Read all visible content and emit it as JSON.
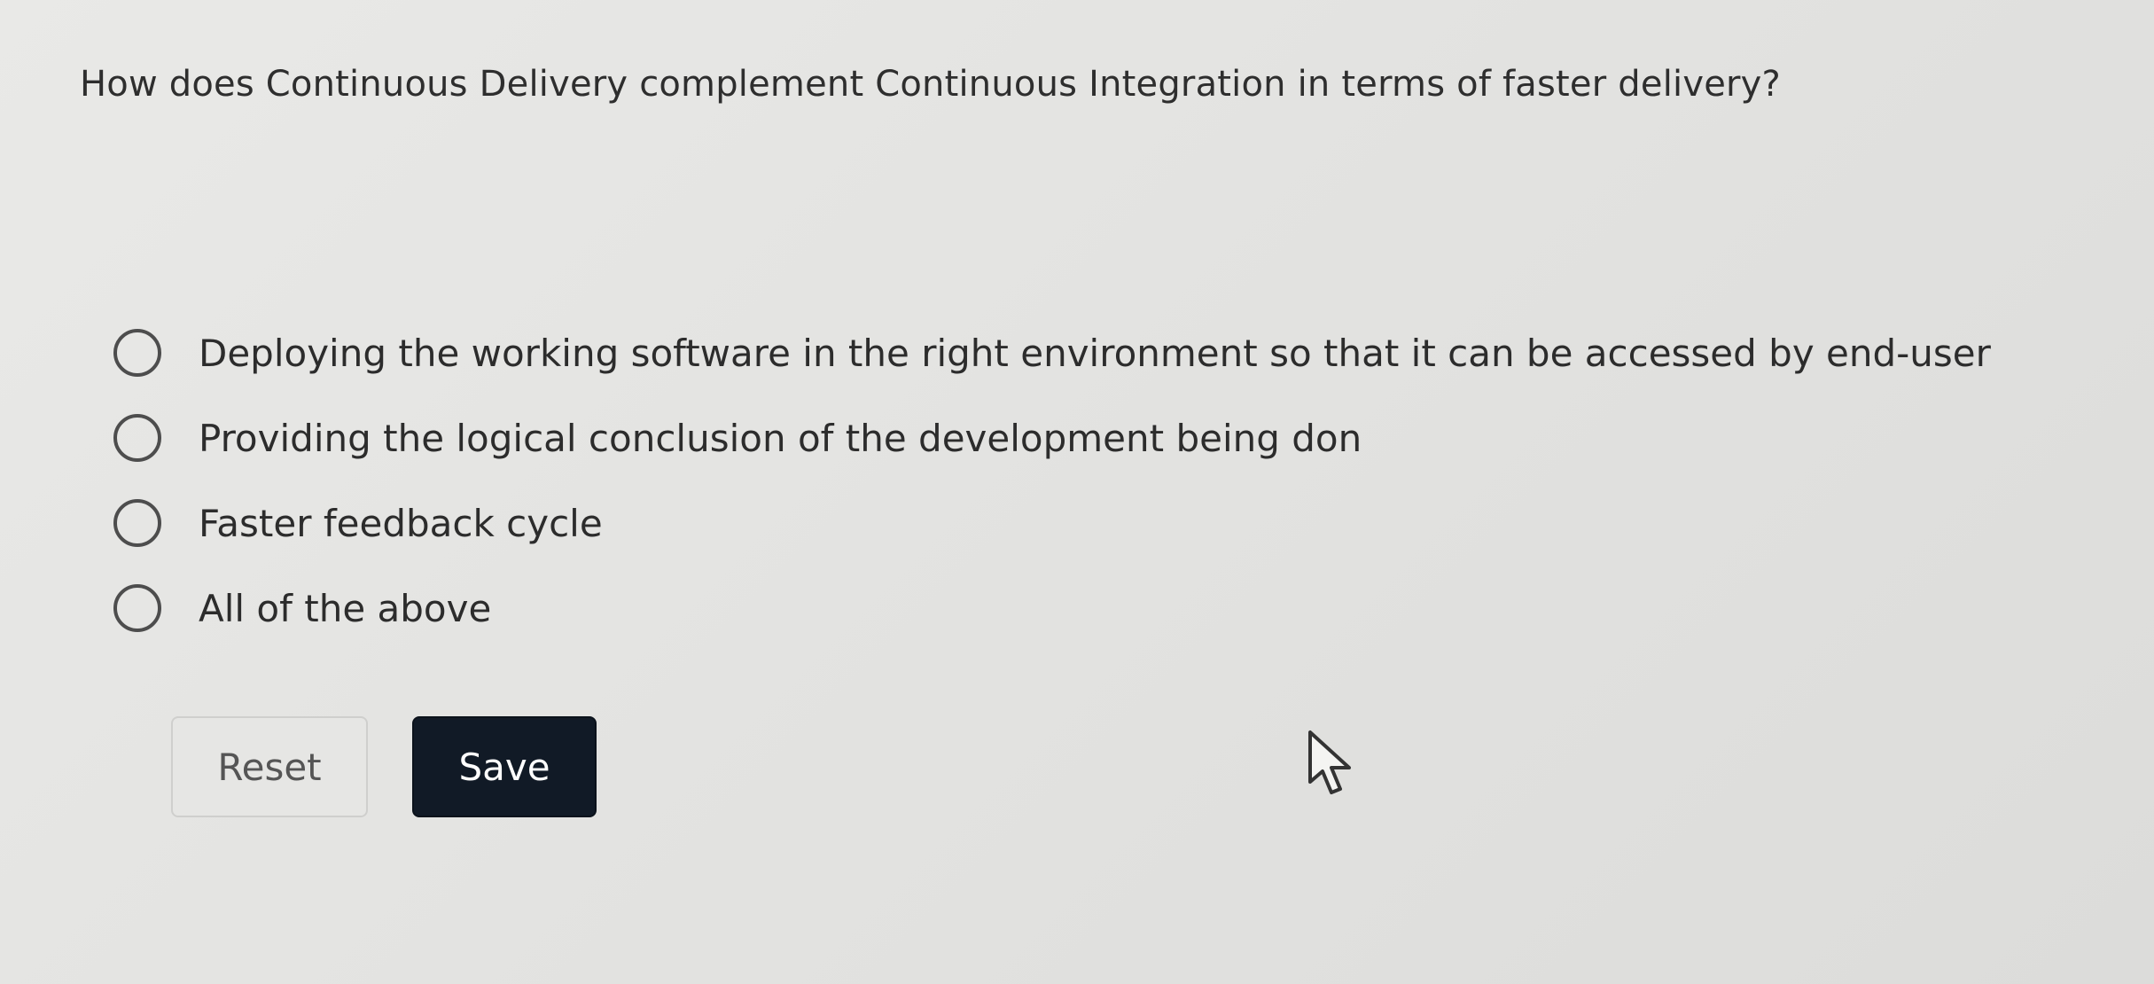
{
  "question": {
    "text": "How does Continuous Delivery complement Continuous Integration in terms of faster delivery?"
  },
  "options": [
    {
      "label": "Deploying the working software in the right environment so that it can be accessed by end-user",
      "selected": false
    },
    {
      "label": "Providing the logical conclusion of the development being don",
      "selected": false
    },
    {
      "label": "Faster feedback cycle",
      "selected": false
    },
    {
      "label": "All of the above",
      "selected": false
    }
  ],
  "buttons": {
    "reset_label": "Reset",
    "save_label": "Save"
  },
  "icons": {
    "cursor": "mouse-pointer-icon"
  },
  "colors": {
    "save_background": "#111a26",
    "save_text": "#ffffff",
    "reset_background": "#e6e6e4",
    "radio_border": "#4d4d4d"
  }
}
